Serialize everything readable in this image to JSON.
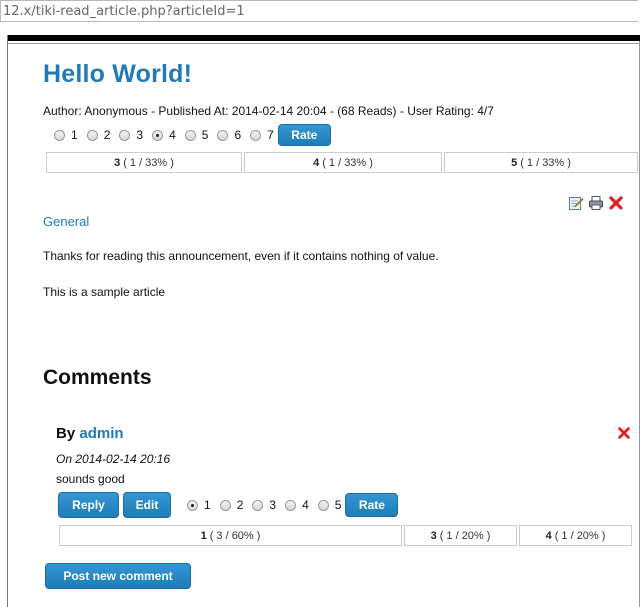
{
  "browser": {
    "url": "12.x/tiki-read_article.php?articleId=1"
  },
  "article": {
    "title": "Hello World!",
    "meta": "Author: Anonymous - Published At: 2014-02-14 20:04 - (68 Reads) - User Rating: 4/7",
    "rating_options": [
      "1",
      "2",
      "3",
      "4",
      "5",
      "6",
      "7"
    ],
    "rating_selected": "4",
    "rate_label": "Rate",
    "results": [
      {
        "value": "3",
        "detail": "( 1 / 33% )"
      },
      {
        "value": "4",
        "detail": "( 1 / 33% )"
      },
      {
        "value": "5",
        "detail": "( 1 / 33% )"
      }
    ],
    "category": "General",
    "body_1": "Thanks for reading this announcement, even if it contains nothing of value.",
    "body_2": "This is a sample article"
  },
  "comments": {
    "heading": "Comments",
    "by_label": "By",
    "items": [
      {
        "author": "admin",
        "date": "On 2014-02-14 20:16",
        "text": "sounds good",
        "reply_label": "Reply",
        "edit_label": "Edit",
        "rating_options": [
          "1",
          "2",
          "3",
          "4",
          "5"
        ],
        "rating_selected": "1",
        "rate_label": "Rate",
        "results": [
          {
            "value": "1",
            "detail": "( 3 / 60% )"
          },
          {
            "value": "3",
            "detail": "( 1 / 20% )"
          },
          {
            "value": "4",
            "detail": "( 1 / 20% )"
          }
        ]
      }
    ],
    "post_label": "Post new comment"
  },
  "icons": [
    "edit-icon",
    "print-icon",
    "delete-icon"
  ],
  "colors": {
    "link": "#1f7ab8",
    "button": "#2a8bc7",
    "delete": "#e02020"
  }
}
